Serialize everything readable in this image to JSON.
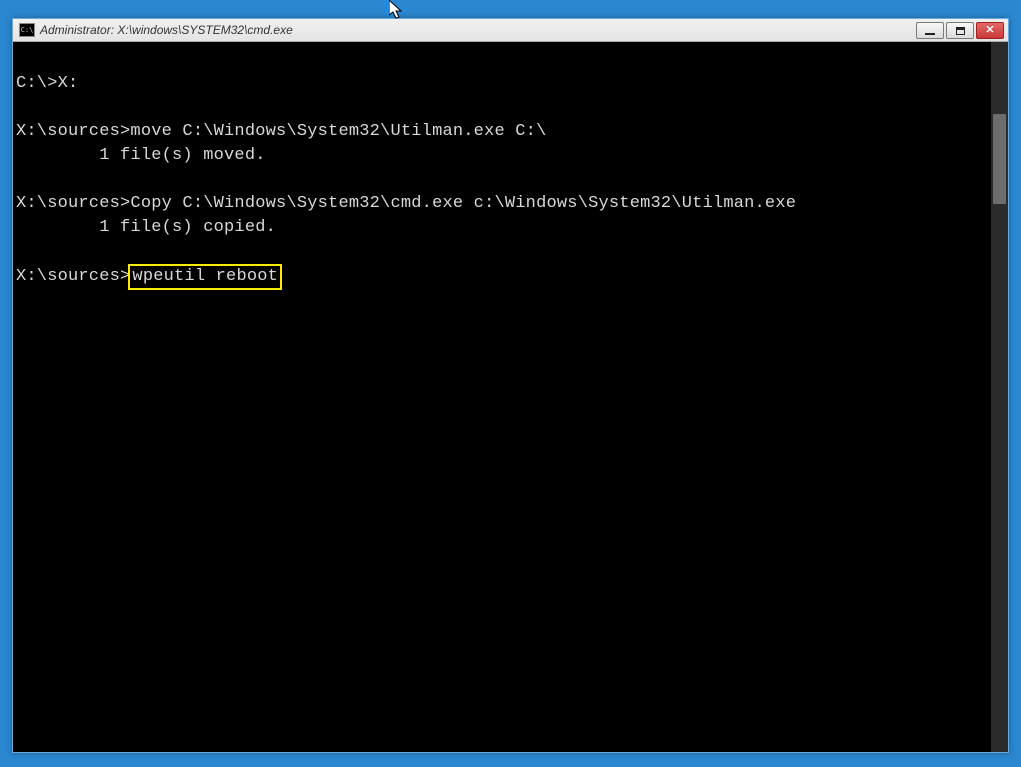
{
  "window": {
    "title": "Administrator: X:\\windows\\SYSTEM32\\cmd.exe",
    "icon_label": "C:\\"
  },
  "terminal": {
    "lines": [
      "",
      "C:\\>X:",
      "",
      "X:\\sources>move C:\\Windows\\System32\\Utilman.exe C:\\",
      "        1 file(s) moved.",
      "",
      "X:\\sources>Copy C:\\Windows\\System32\\cmd.exe c:\\Windows\\System32\\Utilman.exe",
      "        1 file(s) copied.",
      ""
    ],
    "last_line": {
      "prompt": "X:\\sources>",
      "input": "wpeutil reboot"
    }
  }
}
